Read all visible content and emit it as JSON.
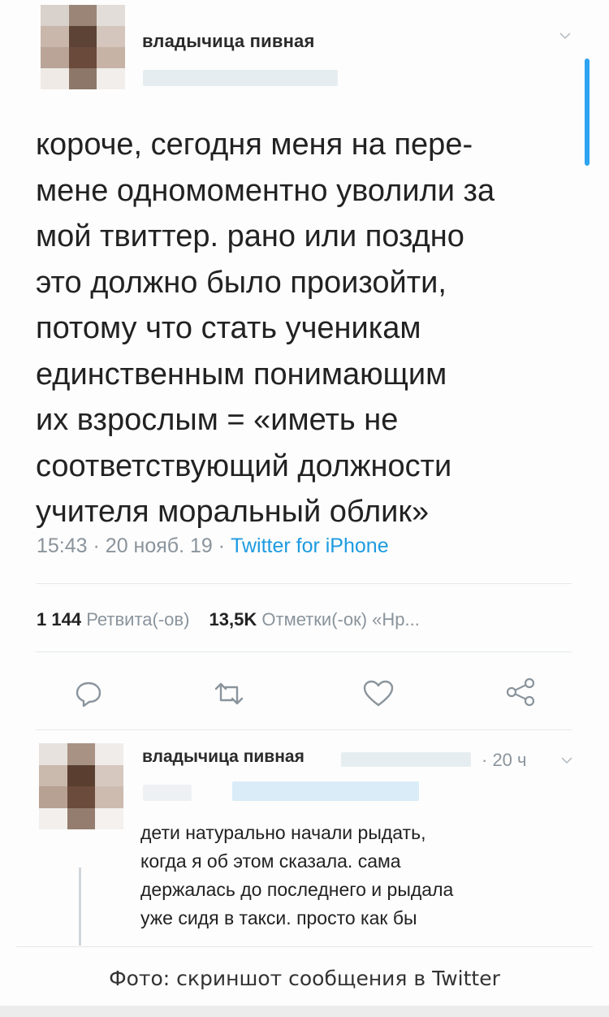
{
  "tweet": {
    "author_name": "владычица пивная",
    "text_lines": [
      "короче, сегодня меня на пере-",
      "мене одномоментно уволили за",
      "мой твиттер. рано или поздно",
      "это должно было произойти,",
      "потому что стать ученикам",
      "единственным понимающим",
      "их взрослым = «иметь не",
      "соответствующий должности",
      "учителя моральный облик»"
    ],
    "time": "15:43",
    "date": "20 нояб. 19",
    "separator": "·",
    "source": "Twitter for iPhone",
    "retweets_count": "1 144",
    "retweets_label": "Ретвита(-ов)",
    "likes_count": "13,5K",
    "likes_label": "Отметки(-ок)",
    "extra_label": "«Нр..."
  },
  "actions": {
    "reply_icon": "reply-icon",
    "retweet_icon": "retweet-icon",
    "like_icon": "heart-icon",
    "share_icon": "share-icon"
  },
  "reply": {
    "author_name": "владычица пивная",
    "time": "· 20 ч",
    "text_lines": [
      "дети натурально начали рыдать,",
      "когда я об этом сказала. сама",
      "держалась до последнего и рыдала",
      "уже сидя в такси. просто как бы"
    ]
  },
  "caption": "Фото: скриншот сообщения в Twitter",
  "colors": {
    "accent": "#1d9be0",
    "muted": "#8a949c",
    "text": "#222222"
  }
}
